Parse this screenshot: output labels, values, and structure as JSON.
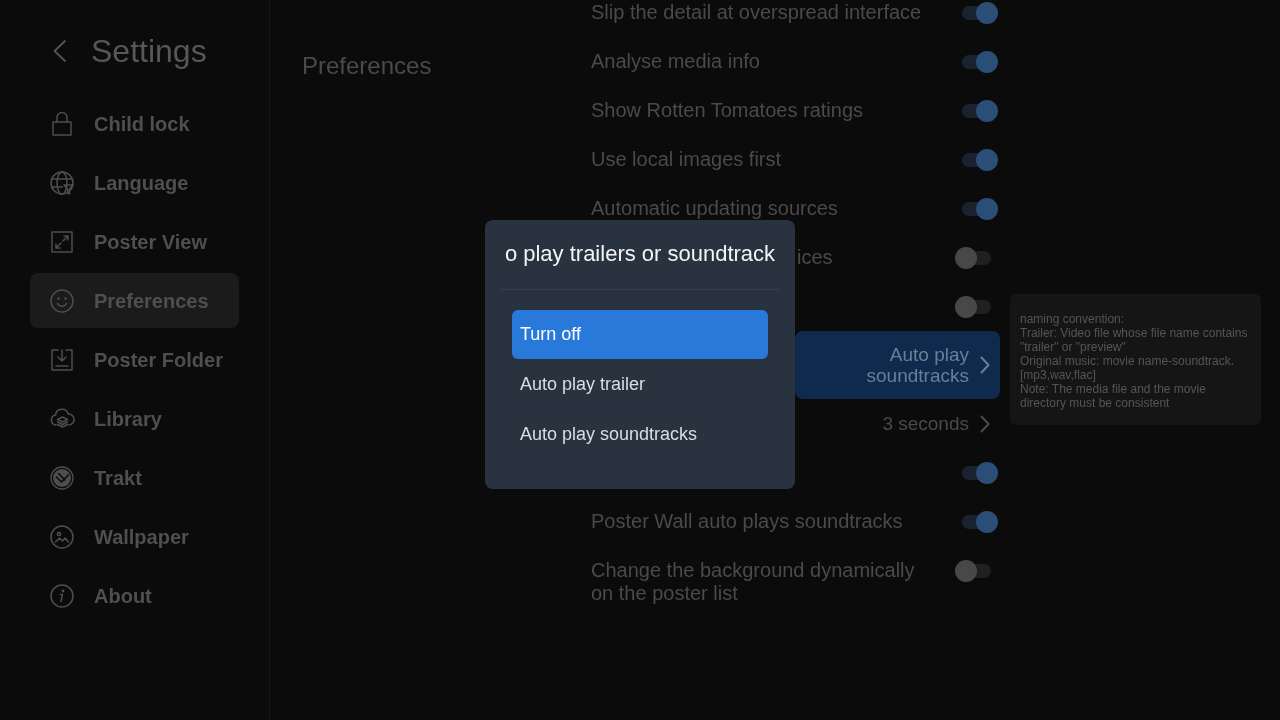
{
  "sidebar": {
    "title": "Settings",
    "items": [
      {
        "label": "Child lock",
        "selected": false
      },
      {
        "label": "Language",
        "selected": false
      },
      {
        "label": "Poster View",
        "selected": false
      },
      {
        "label": "Preferences",
        "selected": true
      },
      {
        "label": "Poster Folder",
        "selected": false
      },
      {
        "label": "Library",
        "selected": false
      },
      {
        "label": "Trakt",
        "selected": false
      },
      {
        "label": "Wallpaper",
        "selected": false
      },
      {
        "label": "About",
        "selected": false
      }
    ]
  },
  "content": {
    "heading": "Preferences"
  },
  "settings": [
    {
      "kind": "toggle",
      "label": "Slip the detail at overspread interface",
      "on": true,
      "selected": false
    },
    {
      "kind": "toggle",
      "label": "Analyse media info",
      "on": true,
      "selected": false
    },
    {
      "kind": "toggle",
      "label": "Show Rotten Tomatoes ratings",
      "on": true,
      "selected": false
    },
    {
      "kind": "toggle",
      "label": "Use local images first",
      "on": true,
      "selected": false
    },
    {
      "kind": "toggle",
      "label": "Automatic updating sources",
      "on": true,
      "selected": false
    },
    {
      "kind": "toggle",
      "label": "ices",
      "on": false,
      "selected": false
    },
    {
      "kind": "toggle",
      "on": false,
      "selected": false
    },
    {
      "kind": "value",
      "value": "Auto play soundtracks",
      "selected": true
    },
    {
      "kind": "value",
      "value": "3 seconds",
      "selected": false
    },
    {
      "kind": "toggle",
      "on": true,
      "selected": false
    },
    {
      "kind": "toggle",
      "label": "Poster Wall auto plays soundtracks",
      "on": true,
      "selected": false
    },
    {
      "kind": "toggle",
      "label": "Change the background dynamically on the poster list",
      "on": false,
      "selected": false
    }
  ],
  "dialog": {
    "title": "o play trailers or soundtrack",
    "options": [
      {
        "label": "Turn off",
        "selected": true
      },
      {
        "label": "Auto play trailer",
        "selected": false
      },
      {
        "label": "Auto play soundtracks",
        "selected": false
      }
    ]
  },
  "tooltip": {
    "lines": [
      "naming convention:",
      "Trailer: Video file whose file name contains \"trailer\" or \"preview\"",
      "Original music: movie name-soundtrack.[mp3,wav,flac]",
      "Note: The media file and the movie directory must be consistent"
    ]
  }
}
